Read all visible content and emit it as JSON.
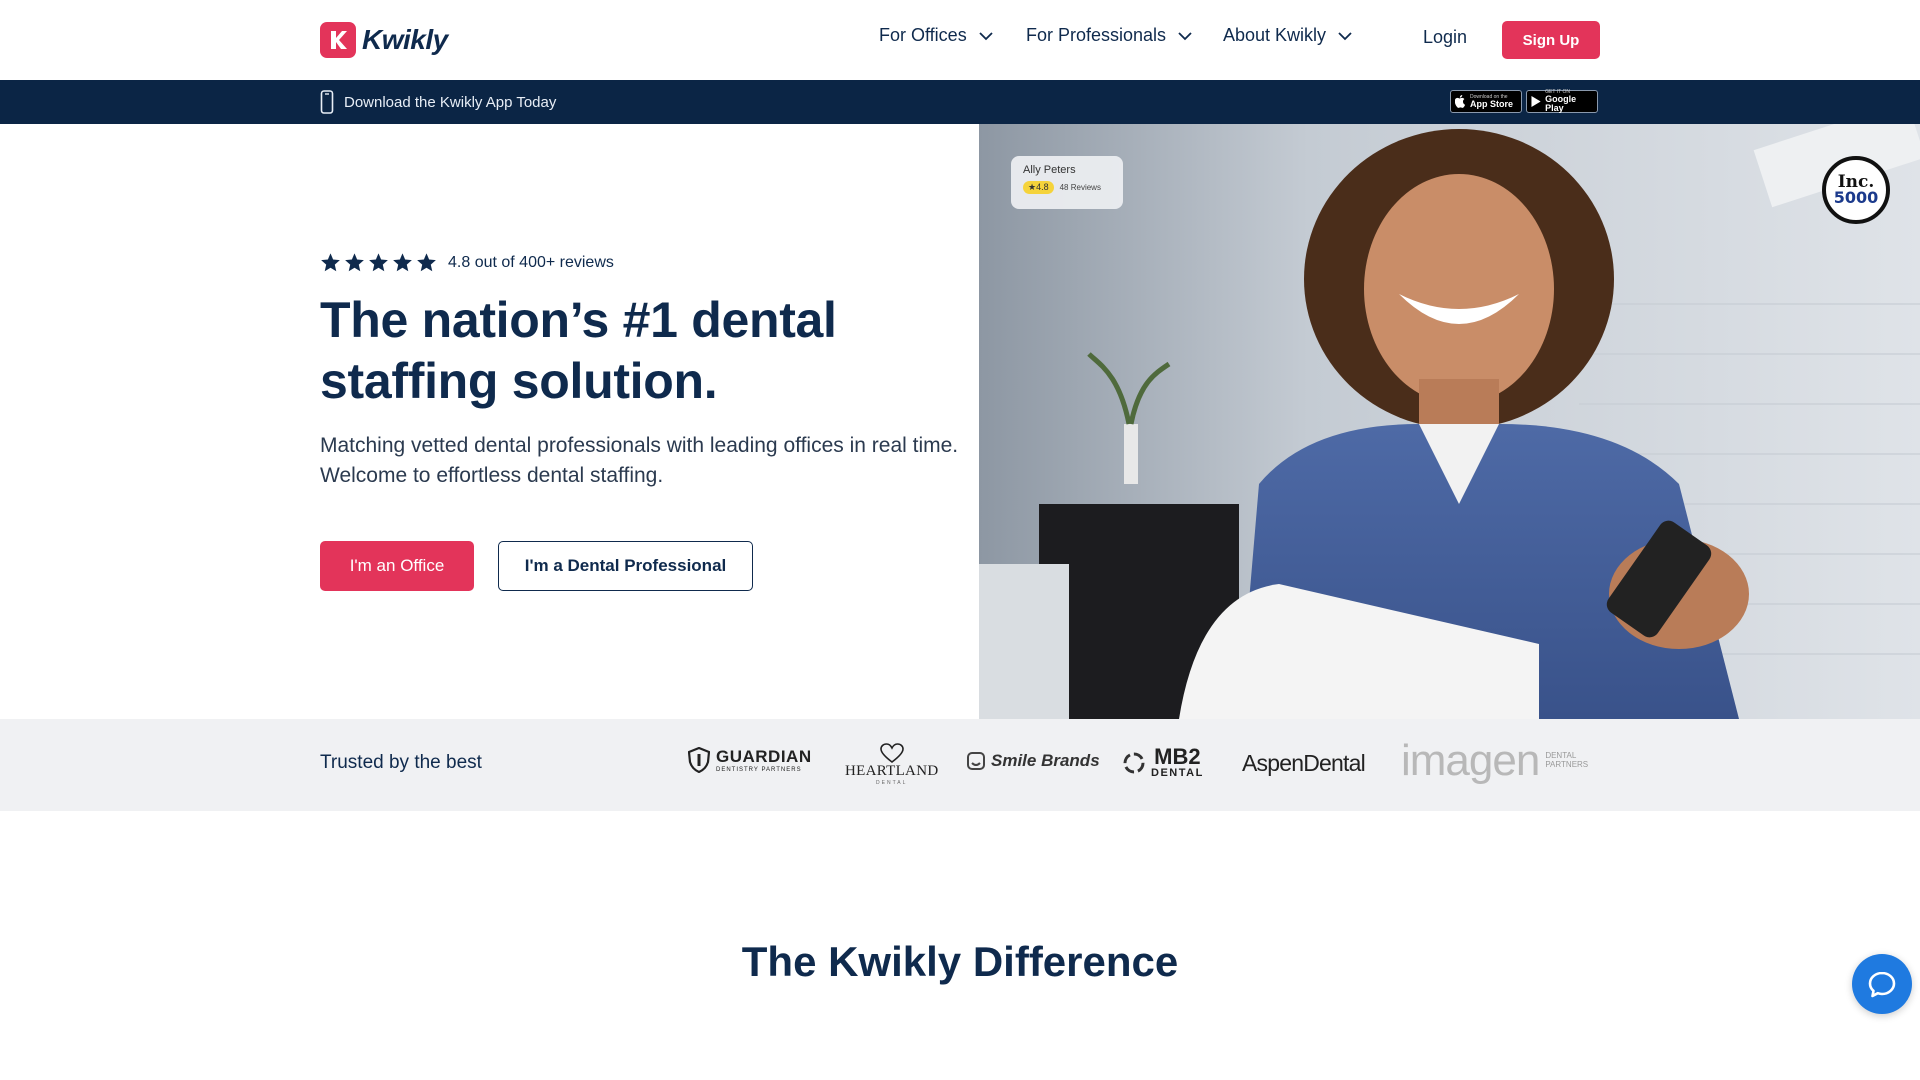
{
  "header": {
    "logo_text": "Kwikly",
    "nav": [
      {
        "label": "For Offices"
      },
      {
        "label": "For Professionals"
      },
      {
        "label": "About Kwikly"
      }
    ],
    "login_label": "Login",
    "signup_label": "Sign Up"
  },
  "banner": {
    "text": "Download the Kwikly App Today",
    "app_store_small": "Download on the",
    "app_store_big": "App Store",
    "google_small": "GET IT ON",
    "google_big": "Google Play"
  },
  "hero": {
    "rating_stars": 5,
    "rating_text": "4.8 out of 400+ reviews",
    "headline": "The nation’s #1 dental staffing solution.",
    "subhead": "Matching vetted dental professionals with leading offices in real time. Welcome to effortless dental staffing.",
    "office_button": "I'm an Office",
    "pro_button": "I'm a Dental Professional",
    "review_card": {
      "name": "Ally Peters",
      "rating": "4.8",
      "count": "48 Reviews"
    },
    "inc_badge": {
      "word": "Inc.",
      "number": "5000"
    }
  },
  "trusted": {
    "label": "Trusted by the best",
    "partners": [
      {
        "name": "GUARDIAN",
        "sub": "DENTISTRY PARTNERS"
      },
      {
        "name": "HEARTLAND",
        "sub": "DENTAL"
      },
      {
        "name": "Smile Brands"
      },
      {
        "name": "MB2",
        "sub": "DENTAL"
      },
      {
        "name": "AspenDental"
      },
      {
        "name": "imagen",
        "sub": "DENTAL PARTNERS"
      }
    ]
  },
  "difference": {
    "title": "The Kwikly Difference"
  },
  "colors": {
    "brand_pink": "#e3345a",
    "navy": "#0f2a4d",
    "banner_navy": "#0b2545",
    "chat_blue": "#1f7ae0"
  },
  "icons": [
    "phone-icon",
    "chevron-down-icon",
    "star-icon",
    "apple-icon",
    "google-play-icon",
    "chat-icon"
  ]
}
